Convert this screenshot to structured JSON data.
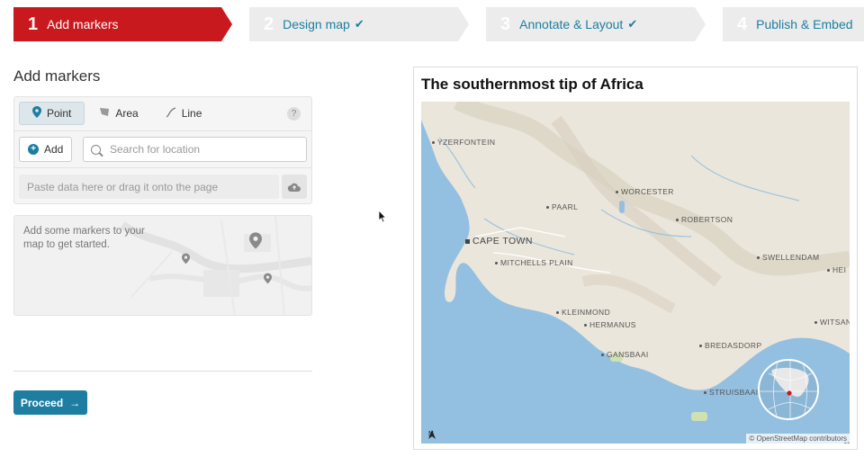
{
  "steps": [
    {
      "num": "1",
      "label": "Add markers",
      "state": "active"
    },
    {
      "num": "2",
      "label": "Design map",
      "state": "done"
    },
    {
      "num": "3",
      "label": "Annotate & Layout",
      "state": "done"
    },
    {
      "num": "4",
      "label": "Publish & Embed",
      "state": "todo"
    }
  ],
  "check_glyph": "✔",
  "panel": {
    "title": "Add markers",
    "tabs": [
      {
        "label": "Point",
        "icon": "map-pin-icon"
      },
      {
        "label": "Area",
        "icon": "area-flag-icon"
      },
      {
        "label": "Line",
        "icon": "line-icon"
      }
    ],
    "help": "?",
    "add_label": "Add",
    "search_placeholder": "Search for location",
    "paste_placeholder": "Paste data here or drag it onto the page",
    "empty_text": "Add some markers to your map to get started.",
    "proceed_label": "Proceed",
    "proceed_arrow": "→"
  },
  "preview": {
    "title": "The southernmost tip of Africa",
    "places": [
      {
        "name": "YZERFONTEIN",
        "kind": "town"
      },
      {
        "name": "WORCESTER",
        "kind": "town"
      },
      {
        "name": "PAARL",
        "kind": "town"
      },
      {
        "name": "ROBERTSON",
        "kind": "town"
      },
      {
        "name": "CAPE TOWN",
        "kind": "city"
      },
      {
        "name": "MITCHELLS PLAIN",
        "kind": "town"
      },
      {
        "name": "SWELLENDAM",
        "kind": "town"
      },
      {
        "name": "HEI",
        "kind": "town"
      },
      {
        "name": "KLEINMOND",
        "kind": "town"
      },
      {
        "name": "HERMANUS",
        "kind": "town"
      },
      {
        "name": "WITSAN",
        "kind": "town"
      },
      {
        "name": "BREDASDORP",
        "kind": "town"
      },
      {
        "name": "GANSBAAI",
        "kind": "town"
      },
      {
        "name": "STRUISBAAI",
        "kind": "town"
      }
    ],
    "north_label": "N",
    "attribution": "© OpenStreetMap contributors"
  },
  "colors": {
    "active_step": "#c8191e",
    "accent": "#1d7ea1",
    "water": "#93bfe0",
    "land": "#ebe6db"
  }
}
